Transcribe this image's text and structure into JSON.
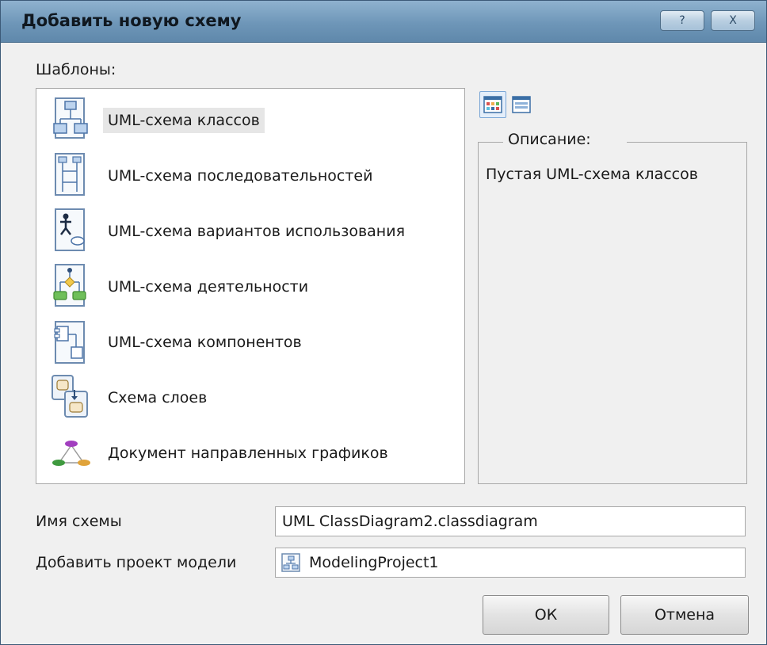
{
  "dialog": {
    "title": "Добавить новую схему",
    "help_label": "?",
    "close_label": "X"
  },
  "templates": {
    "label": "Шаблоны:",
    "items": [
      {
        "label": "UML-схема классов",
        "icon": "class-diagram-icon",
        "selected": true
      },
      {
        "label": "UML-схема последовательностей",
        "icon": "sequence-diagram-icon",
        "selected": false
      },
      {
        "label": "UML-схема вариантов использования",
        "icon": "use-case-diagram-icon",
        "selected": false
      },
      {
        "label": "UML-схема деятельности",
        "icon": "activity-diagram-icon",
        "selected": false
      },
      {
        "label": "UML-схема компонентов",
        "icon": "component-diagram-icon",
        "selected": false
      },
      {
        "label": "Схема слоев",
        "icon": "layer-diagram-icon",
        "selected": false
      },
      {
        "label": "Документ направленных графиков",
        "icon": "directed-graph-icon",
        "selected": false
      }
    ]
  },
  "view_buttons": [
    {
      "icon": "large-icons-view-icon",
      "active": true
    },
    {
      "icon": "list-view-icon",
      "active": false
    }
  ],
  "description": {
    "legend": "Описание:",
    "text": "Пустая UML-схема классов"
  },
  "name_field": {
    "label": "Имя схемы",
    "value": "UML ClassDiagram2.classdiagram"
  },
  "project_field": {
    "label": "Добавить проект модели",
    "value": "ModelingProject1",
    "icon": "modeling-project-icon"
  },
  "buttons": {
    "ok": "ОК",
    "cancel": "Отмена"
  },
  "colors": {
    "titlebar": "#6e96b8",
    "selection": "#e6e6e6",
    "accent": "#7aa6d6"
  }
}
